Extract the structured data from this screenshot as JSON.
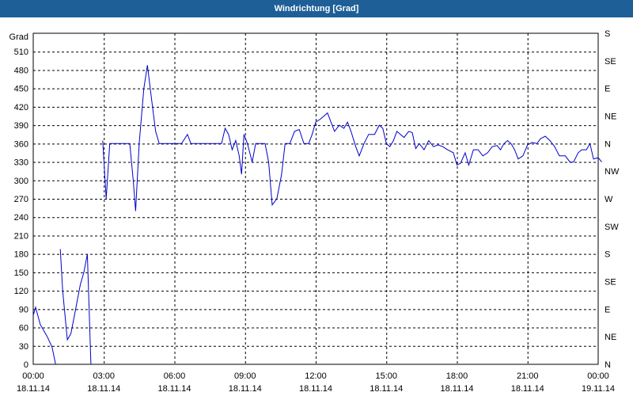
{
  "window": {
    "title": "Windrichtung [Grad]"
  },
  "chart_data": {
    "type": "line",
    "title": "Windrichtung [Grad]",
    "ylabel": "Grad",
    "ylim": [
      0,
      540
    ],
    "yticks": [
      0,
      30,
      60,
      90,
      120,
      150,
      180,
      210,
      240,
      270,
      300,
      330,
      360,
      390,
      420,
      450,
      480,
      510
    ],
    "right_axis": {
      "ticks": [
        0,
        45,
        90,
        135,
        180,
        225,
        270,
        315,
        360,
        405,
        450,
        495,
        540
      ],
      "labels": [
        "N",
        "NE",
        "E",
        "SE",
        "S",
        "SW",
        "W",
        "NW",
        "N",
        "NE",
        "E",
        "SE",
        "S"
      ]
    },
    "xlim": [
      0,
      24
    ],
    "xticks": [
      {
        "pos": 0,
        "line1": "00:00",
        "line2": "18.11.14"
      },
      {
        "pos": 3,
        "line1": "03:00",
        "line2": "18.11.14"
      },
      {
        "pos": 6,
        "line1": "06:00",
        "line2": "18.11.14"
      },
      {
        "pos": 9,
        "line1": "09:00",
        "line2": "18.11.14"
      },
      {
        "pos": 12,
        "line1": "12:00",
        "line2": "18.11.14"
      },
      {
        "pos": 15,
        "line1": "15:00",
        "line2": "18.11.14"
      },
      {
        "pos": 18,
        "line1": "18:00",
        "line2": "18.11.14"
      },
      {
        "pos": 21,
        "line1": "21:00",
        "line2": "18.11.14"
      },
      {
        "pos": 24,
        "line1": "00:00",
        "line2": "19.11.14"
      }
    ],
    "grid": true,
    "series": [
      {
        "color": "#0000cc",
        "segments": [
          [
            [
              0.0,
              80
            ],
            [
              0.1,
              93
            ],
            [
              0.3,
              65
            ],
            [
              0.6,
              45
            ],
            [
              0.8,
              28
            ],
            [
              0.95,
              0
            ]
          ],
          [
            [
              1.15,
              188
            ],
            [
              1.25,
              120
            ],
            [
              1.45,
              40
            ],
            [
              1.6,
              50
            ],
            [
              1.75,
              80
            ],
            [
              2.0,
              130
            ],
            [
              2.15,
              150
            ],
            [
              2.3,
              180
            ],
            [
              2.45,
              0
            ]
          ],
          [
            [
              2.95,
              365
            ],
            [
              3.1,
              270
            ],
            [
              3.25,
              360
            ],
            [
              3.6,
              360
            ],
            [
              4.1,
              360
            ],
            [
              4.25,
              300
            ],
            [
              4.35,
              250
            ],
            [
              4.5,
              360
            ],
            [
              4.7,
              450
            ],
            [
              4.85,
              488
            ],
            [
              5.0,
              440
            ],
            [
              5.2,
              380
            ],
            [
              5.35,
              360
            ],
            [
              5.6,
              360
            ],
            [
              6.0,
              360
            ],
            [
              6.3,
              360
            ],
            [
              6.55,
              375
            ],
            [
              6.7,
              360
            ],
            [
              7.0,
              360
            ],
            [
              7.6,
              360
            ],
            [
              8.0,
              360
            ],
            [
              8.15,
              385
            ],
            [
              8.3,
              375
            ],
            [
              8.45,
              350
            ],
            [
              8.6,
              365
            ],
            [
              8.75,
              340
            ],
            [
              8.85,
              310
            ],
            [
              8.95,
              375
            ],
            [
              9.1,
              360
            ],
            [
              9.3,
              330
            ],
            [
              9.45,
              360
            ],
            [
              9.6,
              360
            ],
            [
              9.85,
              360
            ],
            [
              10.0,
              330
            ],
            [
              10.15,
              260
            ],
            [
              10.35,
              270
            ],
            [
              10.55,
              310
            ],
            [
              10.7,
              360
            ],
            [
              10.9,
              360
            ],
            [
              11.1,
              380
            ],
            [
              11.3,
              383
            ],
            [
              11.5,
              360
            ],
            [
              11.7,
              360
            ],
            [
              11.85,
              375
            ],
            [
              12.0,
              395
            ],
            [
              12.2,
              400
            ],
            [
              12.35,
              405
            ],
            [
              12.5,
              410
            ],
            [
              12.65,
              395
            ],
            [
              12.8,
              380
            ],
            [
              13.0,
              390
            ],
            [
              13.2,
              385
            ],
            [
              13.35,
              395
            ],
            [
              13.5,
              380
            ],
            [
              13.7,
              355
            ],
            [
              13.85,
              340
            ],
            [
              14.05,
              360
            ],
            [
              14.25,
              375
            ],
            [
              14.5,
              375
            ],
            [
              14.7,
              390
            ],
            [
              14.85,
              385
            ],
            [
              15.0,
              360
            ],
            [
              15.15,
              355
            ],
            [
              15.3,
              365
            ],
            [
              15.45,
              380
            ],
            [
              15.6,
              375
            ],
            [
              15.75,
              370
            ],
            [
              15.95,
              380
            ],
            [
              16.1,
              378
            ],
            [
              16.25,
              352
            ],
            [
              16.4,
              360
            ],
            [
              16.6,
              350
            ],
            [
              16.8,
              365
            ],
            [
              17.0,
              355
            ],
            [
              17.2,
              358
            ],
            [
              17.4,
              355
            ],
            [
              17.6,
              350
            ],
            [
              17.85,
              345
            ],
            [
              18.0,
              325
            ],
            [
              18.15,
              328
            ],
            [
              18.35,
              345
            ],
            [
              18.5,
              325
            ],
            [
              18.7,
              350
            ],
            [
              18.9,
              350
            ],
            [
              19.1,
              340
            ],
            [
              19.3,
              345
            ],
            [
              19.5,
              355
            ],
            [
              19.7,
              357
            ],
            [
              19.85,
              350
            ],
            [
              20.0,
              360
            ],
            [
              20.15,
              365
            ],
            [
              20.3,
              360
            ],
            [
              20.45,
              350
            ],
            [
              20.6,
              335
            ],
            [
              20.8,
              340
            ],
            [
              21.0,
              358
            ],
            [
              21.2,
              362
            ],
            [
              21.4,
              360
            ],
            [
              21.55,
              368
            ],
            [
              21.75,
              372
            ],
            [
              21.95,
              365
            ],
            [
              22.15,
              355
            ],
            [
              22.35,
              340
            ],
            [
              22.6,
              340
            ],
            [
              22.8,
              330
            ],
            [
              22.95,
              330
            ],
            [
              23.15,
              345
            ],
            [
              23.3,
              350
            ],
            [
              23.5,
              350
            ],
            [
              23.65,
              360
            ],
            [
              23.8,
              335
            ],
            [
              24.0,
              337
            ],
            [
              24.15,
              330
            ]
          ]
        ]
      }
    ]
  }
}
